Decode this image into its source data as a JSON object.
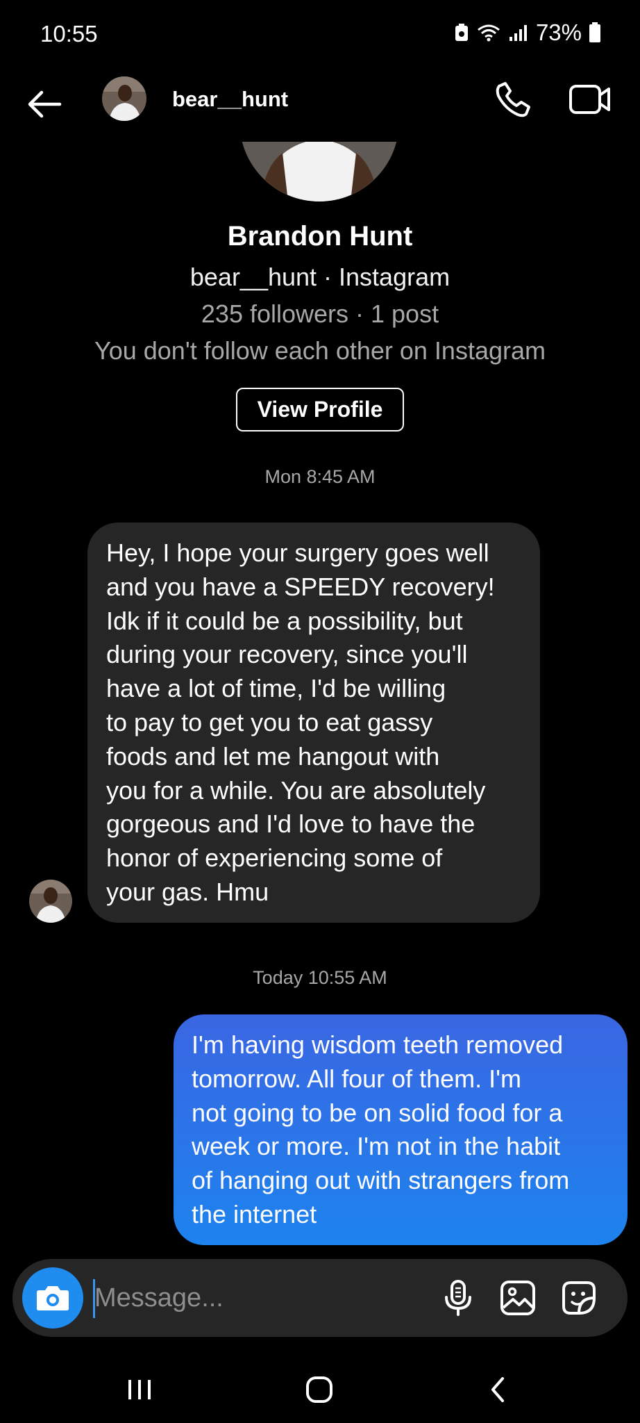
{
  "status_bar": {
    "time": "10:55",
    "battery": "73%"
  },
  "header": {
    "username": "bear__hunt"
  },
  "profile": {
    "name": "Brandon Hunt",
    "handle_line": "bear__hunt · Instagram",
    "stats": "235 followers · 1 post",
    "follow_status": "You don't follow each other on Instagram",
    "view_profile_label": "View Profile"
  },
  "thread": {
    "timestamp_1": "Mon 8:45 AM",
    "incoming_lines": [
      "Hey, I hope your surgery goes well",
      "and you have a SPEEDY recovery!",
      "Idk if it could be a possibility, but",
      "during your recovery, since you'll",
      "have a lot of time, I'd be willing",
      "to pay to get you to eat gassy",
      "foods and let me hangout with",
      "you for a while. You are absolutely",
      "gorgeous and I'd love to have the",
      "honor of experiencing some of",
      "your gas. Hmu"
    ],
    "timestamp_2": "Today 10:55 AM",
    "outgoing_lines": [
      "I'm having wisdom teeth removed",
      "tomorrow. All four of them. I'm",
      "not going to be on solid food for a",
      "week or more. I'm not in the habit",
      "of hanging out with strangers from",
      "the internet"
    ]
  },
  "composer": {
    "placeholder": "Message..."
  },
  "colors": {
    "accent_blue": "#1f8cf0",
    "bubble_incoming": "#262626",
    "bubble_outgoing_top": "#3a66e2",
    "bubble_outgoing_bottom": "#1d83ee"
  },
  "icons": [
    "back-arrow-icon",
    "phone-icon",
    "video-camera-icon",
    "camera-icon",
    "microphone-icon",
    "gallery-icon",
    "sticker-icon",
    "recents-icon",
    "home-icon",
    "nav-back-icon"
  ]
}
